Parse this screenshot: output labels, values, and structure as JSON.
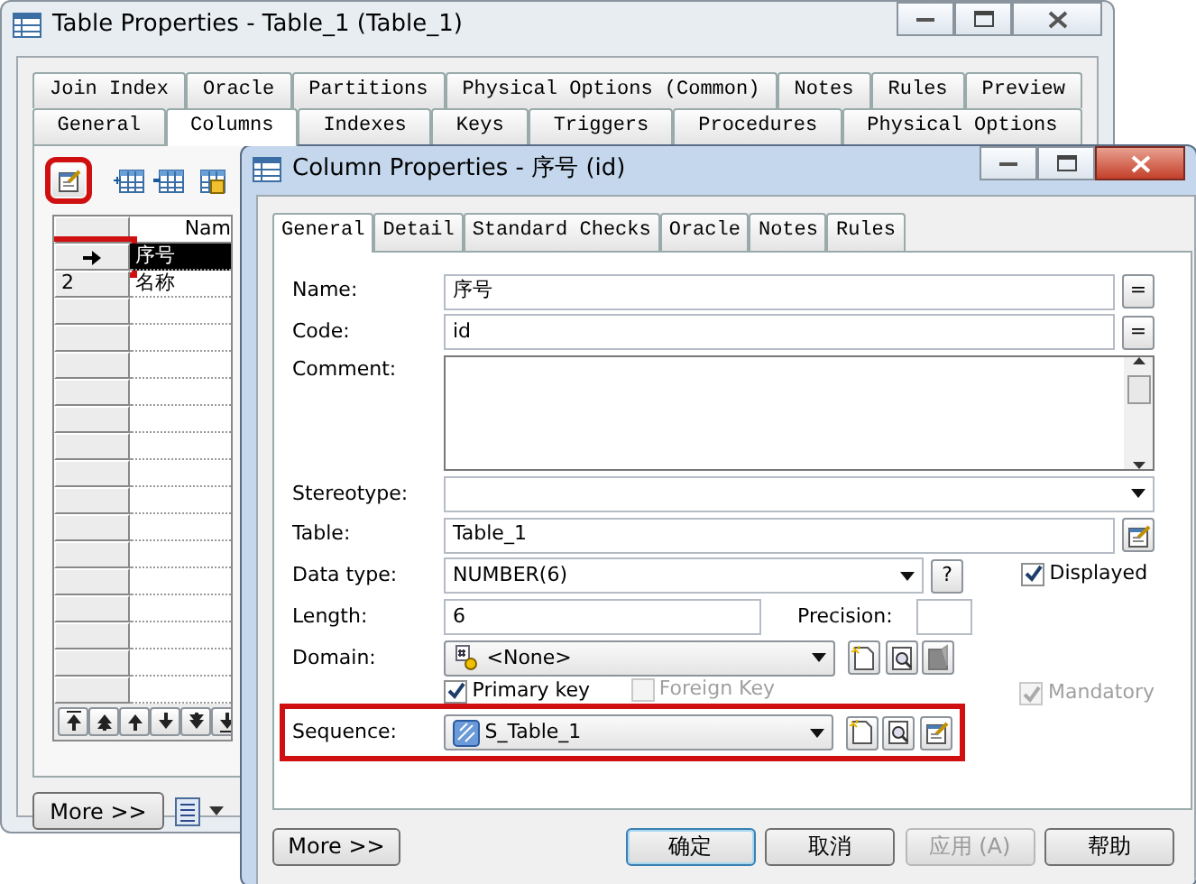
{
  "back_window": {
    "title": "Table Properties - Table_1 (Table_1)",
    "tabs_row_1": [
      {
        "label": "Join Index",
        "selected": false
      },
      {
        "label": "Oracle",
        "selected": false
      },
      {
        "label": "Partitions",
        "selected": false
      },
      {
        "label": "Physical Options (Common)",
        "selected": false
      },
      {
        "label": "Notes",
        "selected": false
      },
      {
        "label": "Rules",
        "selected": false
      },
      {
        "label": "Preview",
        "selected": false
      }
    ],
    "tabs_row_2": [
      {
        "label": "General",
        "selected": false
      },
      {
        "label": "Columns",
        "selected": true
      },
      {
        "label": "Indexes",
        "selected": false
      },
      {
        "label": "Keys",
        "selected": false
      },
      {
        "label": "Triggers",
        "selected": false
      },
      {
        "label": "Procedures",
        "selected": false
      },
      {
        "label": "Physical Options",
        "selected": false
      }
    ],
    "properties_button": {
      "highlighted": true
    },
    "grid": {
      "column_header": "Nam",
      "rows": [
        {
          "current": true,
          "highlighted": true,
          "selected": true,
          "name": "序号"
        },
        {
          "current": false,
          "highlighted": false,
          "selected": false,
          "number": "2",
          "name": "名称"
        }
      ]
    },
    "more_button": "More >>"
  },
  "front_window": {
    "title": "Column Properties - 序号 (id)",
    "tabs": [
      {
        "label": "General",
        "selected": true
      },
      {
        "label": "Detail",
        "selected": false
      },
      {
        "label": "Standard Checks",
        "selected": false
      },
      {
        "label": "Oracle",
        "selected": false
      },
      {
        "label": "Notes",
        "selected": false
      },
      {
        "label": "Rules",
        "selected": false
      }
    ],
    "name": {
      "label": "Name:",
      "value": "序号",
      "button": "="
    },
    "code": {
      "label": "Code:",
      "value": "id",
      "button": "="
    },
    "comment": {
      "label": "Comment:"
    },
    "stereotype": {
      "label": "Stereotype:"
    },
    "table": {
      "label": "Table:",
      "value": "Table_1"
    },
    "data_type": {
      "label": "Data type:",
      "value": "NUMBER(6)",
      "button": "?"
    },
    "displayed": {
      "label": "Displayed",
      "checked": true,
      "disabled": false
    },
    "length": {
      "label": "Length:",
      "value": "6"
    },
    "precision": {
      "label": "Precision:"
    },
    "domain": {
      "label": "Domain:",
      "value": "<None>"
    },
    "checkboxes": [
      {
        "label": "Primary key",
        "checked": true,
        "disabled": false
      },
      {
        "label": "Foreign Key",
        "checked": false,
        "disabled": true
      },
      {
        "label": "Mandatory",
        "checked": true,
        "disabled": true
      }
    ],
    "sequence": {
      "label": "Sequence:",
      "value": "S_Table_1",
      "highlighted": true
    },
    "more_button": "More >>",
    "buttons": [
      {
        "label": "确定",
        "default": true,
        "disabled": false
      },
      {
        "label": "取消",
        "default": false,
        "disabled": false
      },
      {
        "label": "应用 (A)",
        "default": false,
        "disabled": true
      },
      {
        "label": "帮助",
        "default": false,
        "disabled": false
      }
    ]
  }
}
